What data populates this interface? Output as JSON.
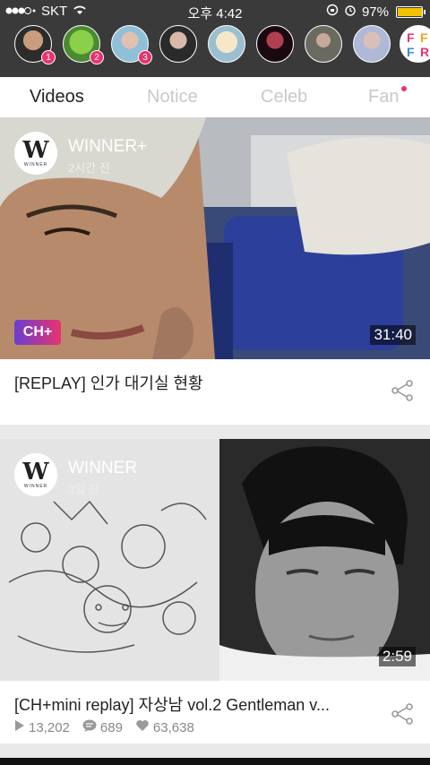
{
  "status_bar": {
    "carrier": "SKT",
    "time": "오후 4:42",
    "battery": "97%",
    "battery_level": 0.97
  },
  "story_row": {
    "avatars": [
      {
        "badge": "1"
      },
      {
        "badge": "2"
      },
      {
        "badge": "3"
      },
      {
        "badge": ""
      },
      {
        "badge": ""
      },
      {
        "badge": ""
      },
      {
        "badge": ""
      },
      {
        "badge": ""
      }
    ],
    "last_letters": [
      "F",
      "F",
      "F",
      "R"
    ]
  },
  "tabs": {
    "items": [
      "Videos",
      "Notice",
      "Celeb",
      "Fan"
    ],
    "active": "Videos"
  },
  "feed": [
    {
      "channel": "WINNER+",
      "time": "2시간 전",
      "duration": "31:40",
      "tag": "CH+",
      "title": "[REPLAY] 인가 대기실 현황"
    },
    {
      "channel": "WINNER",
      "time": "3일 전",
      "duration": "2:59",
      "title": "[CH+mini replay] 자상남 vol.2 Gentleman v...",
      "views": "13,202",
      "comments": "689",
      "likes": "63,638"
    }
  ],
  "logo_text": "WINNER",
  "colors": {
    "accent": "#e8336e",
    "status_bar": "#3a3a3a"
  }
}
